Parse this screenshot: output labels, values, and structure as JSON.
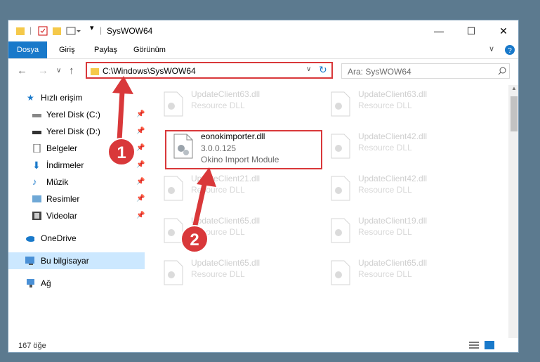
{
  "window": {
    "title": "SysWOW64"
  },
  "ribbon": {
    "tabs": [
      "Dosya",
      "Giriş",
      "Paylaş",
      "Görünüm"
    ]
  },
  "address": {
    "path": "C:\\Windows\\SysWOW64",
    "search_placeholder": "Ara: SysWOW64"
  },
  "sidebar": {
    "quick_access": "Hızlı erişim",
    "items": [
      "Yerel Disk (C:)",
      "Yerel Disk (D:)",
      "Belgeler",
      "İndirmeler",
      "Müzik",
      "Resimler",
      "Videolar"
    ],
    "onedrive": "OneDrive",
    "this_pc": "Bu bilgisayar",
    "network": "Ağ"
  },
  "files": {
    "highlighted": {
      "name": "eonokimporter.dll",
      "version": "3.0.0.125",
      "description": "Okino Import Module"
    },
    "ghost_left": [
      {
        "name": "UpdateClient63.dll",
        "type": "Resource DLL"
      },
      {
        "name": "UpdateClient21.dll",
        "type": "Resource DLL"
      },
      {
        "name": "UpdateClient65.dll",
        "type": "Resource DLL"
      },
      {
        "name": "UpdateClient65.dll",
        "type": "Resource DLL"
      }
    ],
    "ghost_right": [
      {
        "name": "UpdateClient63.dll",
        "type": "Resource DLL"
      },
      {
        "name": "UpdateClient42.dll",
        "type": "Resource DLL"
      },
      {
        "name": "UpdateClient42.dll",
        "type": "Resource DLL"
      },
      {
        "name": "UpdateClient19.dll",
        "type": "Resource DLL"
      },
      {
        "name": "UpdateClient65.dll",
        "type": "Resource DLL"
      }
    ]
  },
  "status": {
    "count": "167 öğe"
  },
  "annotations": {
    "step1": "1",
    "step2": "2"
  },
  "colors": {
    "accent": "#1979ca",
    "highlight": "#d9383a",
    "selected": "#cce8ff"
  }
}
